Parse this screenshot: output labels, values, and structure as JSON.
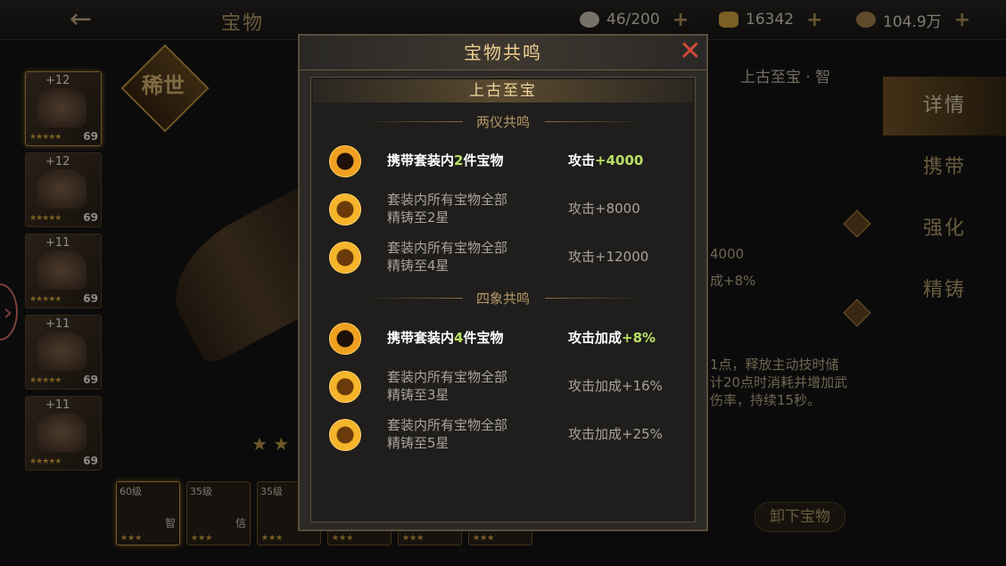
{
  "header": {
    "title": "宝物",
    "back_icon": "←",
    "resources": [
      {
        "icon": "stamina-icon",
        "value": "46/200"
      },
      {
        "icon": "ingot-icon",
        "value": "16342"
      },
      {
        "icon": "coin-icon",
        "value": "104.9万"
      }
    ],
    "plus": "+"
  },
  "heroes": [
    {
      "plus": "+12",
      "level": "69",
      "stars": "★★★★★"
    },
    {
      "plus": "+12",
      "level": "69",
      "stars": "★★★★★"
    },
    {
      "plus": "+11",
      "level": "69",
      "stars": "★★★★★"
    },
    {
      "plus": "+11",
      "level": "69",
      "stars": "★★★★★"
    },
    {
      "plus": "+11",
      "level": "69",
      "stars": "★★★★★"
    }
  ],
  "side_handle": "›",
  "scene": {
    "rarity_badge": "稀世",
    "stars": "★ ★",
    "set_title": "上古至宝 · 智",
    "bg_values": [
      "4000",
      "成+8%"
    ],
    "bg_desc": [
      "1点，释放主动技时储",
      "计20点时消耗并增加武",
      "伤率，持续15秒。"
    ],
    "unequip_label": "卸下宝物"
  },
  "slots": [
    {
      "level": "60级",
      "tag": "智",
      "stars": "★★★"
    },
    {
      "level": "35级",
      "tag": "信",
      "stars": "★★★"
    },
    {
      "level": "35级",
      "tag": "",
      "stars": "★★★"
    },
    {
      "level": "",
      "tag": "",
      "stars": "★★★"
    },
    {
      "level": "",
      "tag": "",
      "stars": "★★★"
    },
    {
      "level": "",
      "tag": "",
      "stars": "★★★"
    }
  ],
  "tabs": [
    "详情",
    "携带",
    "强化",
    "精铸"
  ],
  "modal": {
    "title": "宝物共鸣",
    "close": "✕",
    "set_name": "上古至宝",
    "sections": [
      {
        "name": "两仪共鸣",
        "rows": [
          {
            "active": true,
            "cond_pre": "携带套装内",
            "cond_hl": "2",
            "cond_post": "件宝物",
            "cond_line2": "",
            "eff_pre": "攻击",
            "eff_val": "+4000"
          },
          {
            "active": false,
            "cond_pre": "套装内所有宝物全部",
            "cond_hl": "",
            "cond_post": "",
            "cond_line2": "精铸至2星",
            "eff_pre": "攻击",
            "eff_val": "+8000"
          },
          {
            "active": false,
            "cond_pre": "套装内所有宝物全部",
            "cond_hl": "",
            "cond_post": "",
            "cond_line2": "精铸至4星",
            "eff_pre": "攻击",
            "eff_val": "+12000"
          }
        ]
      },
      {
        "name": "四象共鸣",
        "rows": [
          {
            "active": true,
            "cond_pre": "携带套装内",
            "cond_hl": "4",
            "cond_post": "件宝物",
            "cond_line2": "",
            "eff_pre": "攻击加成",
            "eff_val": "+8%"
          },
          {
            "active": false,
            "cond_pre": "套装内所有宝物全部",
            "cond_hl": "",
            "cond_post": "",
            "cond_line2": "精铸至3星",
            "eff_pre": "攻击加成",
            "eff_val": "+16%"
          },
          {
            "active": false,
            "cond_pre": "套装内所有宝物全部",
            "cond_hl": "",
            "cond_post": "",
            "cond_line2": "精铸至5星",
            "eff_pre": "攻击加成",
            "eff_val": "+25%"
          }
        ]
      }
    ]
  }
}
